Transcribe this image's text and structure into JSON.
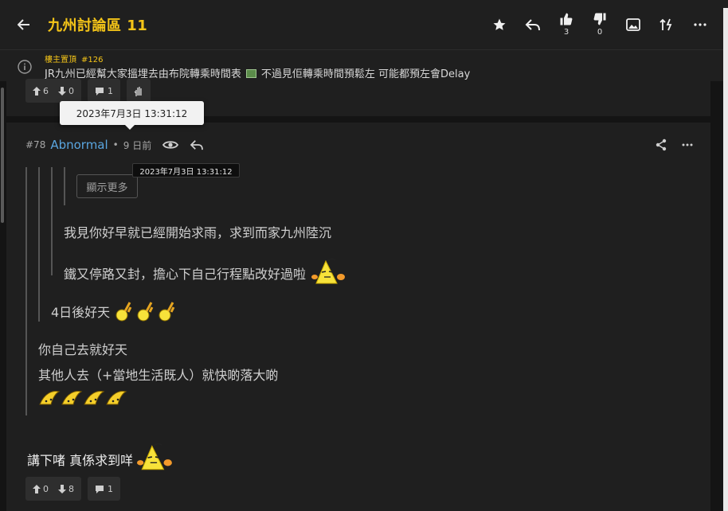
{
  "topbar": {
    "title": "九州討論區 11",
    "like_count": "3",
    "dislike_count": "0"
  },
  "pinned": {
    "tag": "樓主置頂",
    "post_no": "#126",
    "text_before_image": "JR九州已經幫大家搵埋去由布院轉乘時間表",
    "text_after_image": "不過見佢轉乘時間預鬆左 可能都預左會Delay"
  },
  "prev_post": {
    "upvotes": "6",
    "downvotes": "0",
    "replies": "1"
  },
  "tooltips": {
    "large": "2023年7月3日 13:31:12",
    "small": "2023年7月3日 13:31:12"
  },
  "post": {
    "number": "#78",
    "author": "Abnormal",
    "separator": "•",
    "time_ago": "9 日前",
    "show_more": "顯示更多",
    "quote_l3_line1": "我見你好早就已經開始求雨，求到而家九州陸沉",
    "quote_l3_line2": "鐵又停路又封，擔心下自己行程點改好過啦",
    "quote_l2_line1": "4日後好天",
    "quote_l1_line1": "你自己去就好天",
    "quote_l1_line2": "其他人去（+當地生活既人）就快啲落大啲",
    "body": "講下啫 真係求到咩",
    "upvotes": "0",
    "downvotes": "8",
    "replies": "1"
  },
  "colors": {
    "accent": "#f5c518",
    "author": "#5aa6e0",
    "background": "#141414",
    "card": "#1f1f1f"
  }
}
